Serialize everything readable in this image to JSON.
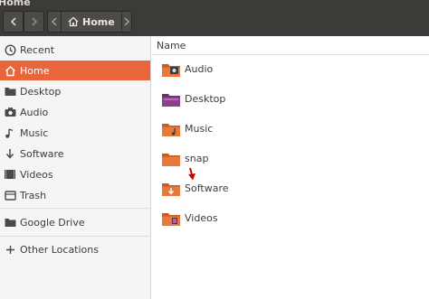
{
  "window": {
    "title": "Home"
  },
  "pathbar": {
    "location": "Home"
  },
  "sidebar": {
    "items": [
      {
        "label": "Recent"
      },
      {
        "label": "Home"
      },
      {
        "label": "Desktop"
      },
      {
        "label": "Audio"
      },
      {
        "label": "Music"
      },
      {
        "label": "Software"
      },
      {
        "label": "Videos"
      },
      {
        "label": "Trash"
      },
      {
        "label": "Google Drive"
      },
      {
        "label": "Other Locations"
      }
    ],
    "active_item": "Home"
  },
  "list": {
    "column_header": "Name",
    "files": [
      {
        "name": "Audio",
        "emblem": "audio-emblem-icon"
      },
      {
        "name": "Desktop",
        "emblem": "desktop-emblem-icon"
      },
      {
        "name": "Music",
        "emblem": "music-emblem-icon"
      },
      {
        "name": "snap",
        "emblem": ""
      },
      {
        "name": "Software",
        "emblem": "software-emblem-icon"
      },
      {
        "name": "Videos",
        "emblem": "video-emblem-icon"
      }
    ]
  },
  "colors": {
    "accent": "#e9653b",
    "folder_orange": "#e8793c",
    "desktop_folder": "#8d3f8d",
    "annotation_arrow": "#cc0000"
  }
}
